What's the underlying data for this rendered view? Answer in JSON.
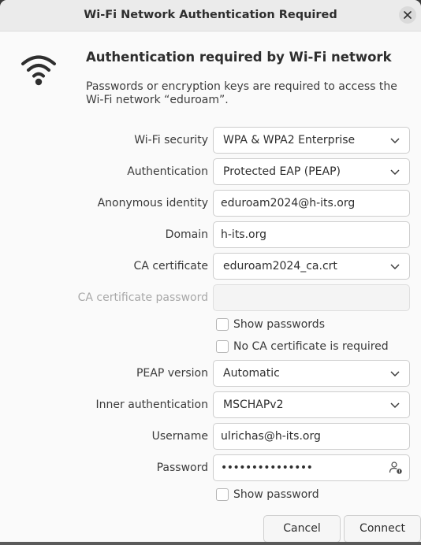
{
  "window": {
    "title": "Wi-Fi Network Authentication Required"
  },
  "header": {
    "icon": "wifi-icon",
    "heading": "Authentication required by Wi-Fi network",
    "description": "Passwords or encryption keys are required to access the Wi-Fi network “eduroam”."
  },
  "form": {
    "wifi_security": {
      "label": "Wi-Fi security",
      "value": "WPA & WPA2 Enterprise"
    },
    "authentication": {
      "label": "Authentication",
      "value": "Protected EAP (PEAP)"
    },
    "anonymous_identity": {
      "label": "Anonymous identity",
      "value": "eduroam2024@h-its.org"
    },
    "domain": {
      "label": "Domain",
      "value": "h-its.org"
    },
    "ca_certificate": {
      "label": "CA certificate",
      "value": "eduroam2024_ca.crt"
    },
    "ca_certificate_password": {
      "label": "CA certificate password",
      "value": ""
    },
    "show_passwords": {
      "label": "Show passwords",
      "checked": false
    },
    "no_ca_required": {
      "label": "No CA certificate is required",
      "checked": false
    },
    "peap_version": {
      "label": "PEAP version",
      "value": "Automatic"
    },
    "inner_authentication": {
      "label": "Inner authentication",
      "value": "MSCHAPv2"
    },
    "username": {
      "label": "Username",
      "value": "ulrichas@h-its.org"
    },
    "password": {
      "label": "Password",
      "value": "•••••••••••••••"
    },
    "show_password": {
      "label": "Show password",
      "checked": false
    }
  },
  "buttons": {
    "cancel": "Cancel",
    "connect": "Connect"
  }
}
